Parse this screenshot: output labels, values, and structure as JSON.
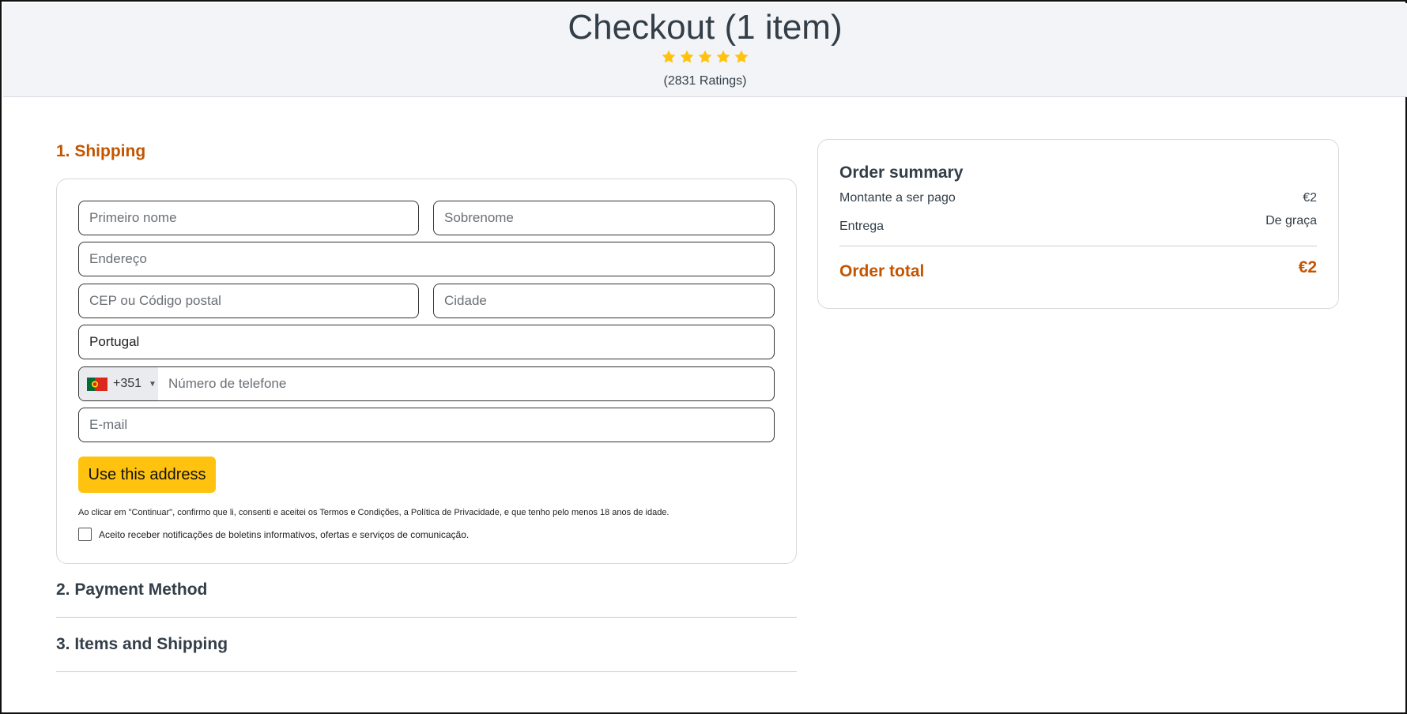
{
  "header": {
    "title": "Checkout (1 item)",
    "rating_stars": 5,
    "ratings_text": "(2831 Ratings)",
    "star_color": "#ffc20e"
  },
  "shipping": {
    "heading": "1. Shipping",
    "first_name_placeholder": "Primeiro nome",
    "last_name_placeholder": "Sobrenome",
    "address_placeholder": "Endereço",
    "postal_placeholder": "CEP ou Código postal",
    "city_placeholder": "Cidade",
    "country_value": "Portugal",
    "phone_prefix": "+351",
    "phone_flag_icon": "portugal-flag-icon",
    "phone_placeholder": "Número de telefone",
    "email_placeholder": "E-mail",
    "submit_label": "Use this address",
    "legal_text": "Ao clicar em \"Continuar\", confirmo que li, consenti e aceitei os Termos e Condições, a Política de Privacidade, e que tenho pelo menos 18 anos de idade.",
    "newsletter_label": "Aceito receber notificações de boletins informativos, ofertas e serviços de comunicação.",
    "newsletter_checked": false
  },
  "steps": {
    "payment": "2. Payment Method",
    "items": "3. Items and Shipping"
  },
  "summary": {
    "title": "Order summary",
    "amount_label": "Montante a ser pago",
    "amount_value": "€2",
    "delivery_label": "Entrega",
    "delivery_value": "De graça",
    "total_label": "Order total",
    "total_value": "€2"
  },
  "colors": {
    "accent": "#c45500",
    "button": "#ffc20e",
    "header_bg": "#f2f4f7"
  }
}
